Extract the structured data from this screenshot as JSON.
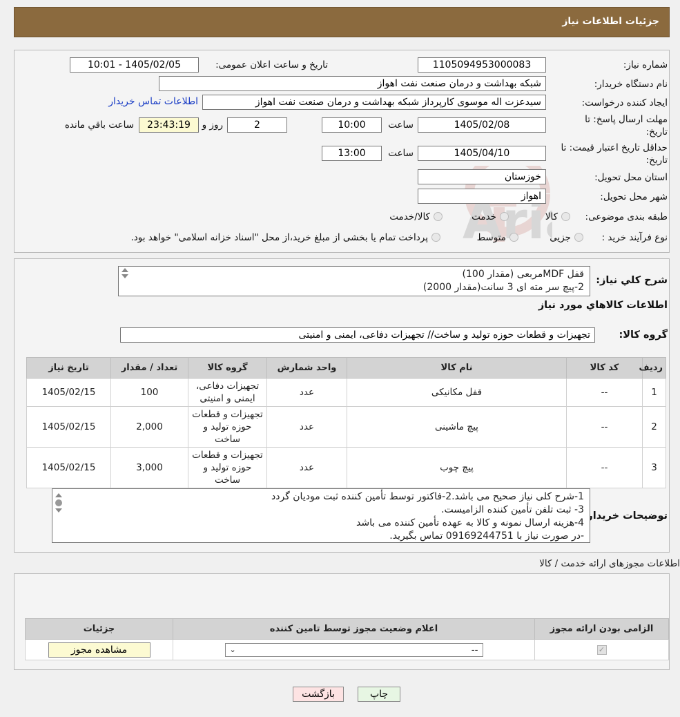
{
  "header": {
    "title": "جزئیات اطلاعات نیاز"
  },
  "form": {
    "need_number_label": "شماره نیاز:",
    "need_number": "1105094953000083",
    "announce_label": "تاریخ و ساعت اعلان عمومی:",
    "announce_value": "1405/02/05 - 10:01",
    "buyer_org_label": "نام دستگاه خریدار:",
    "buyer_org": "شبکه بهداشت و درمان صنعت نفت اهواز",
    "creator_label": "ایجاد کننده درخواست:",
    "creator": "سیدعزت اله موسوی کارپرداز شبکه بهداشت و درمان صنعت نفت اهواز",
    "contact_link": "اطلاعات تماس خریدار",
    "deadline_label_1": "مهلت ارسال پاسخ: تا",
    "deadline_label_2": "تاریخ:",
    "deadline_date": "1405/02/08",
    "time_label": "ساعت",
    "deadline_time": "10:00",
    "days_remaining": "2",
    "days_and_label": "روز و",
    "time_remaining": "23:43:19",
    "remaining_label": "ساعت باقي مانده",
    "validity_label_1": "حداقل تاریخ اعتبار قیمت: تا",
    "validity_label_2": "تاریخ:",
    "validity_date": "1405/04/10",
    "validity_time": "13:00",
    "province_label": "استان محل تحویل:",
    "province": "خوزستان",
    "city_label": "شهر محل تحویل:",
    "city": "اهواز",
    "category_label": "طبقه بندی موضوعی:",
    "category_options": [
      "کالا",
      "خدمت",
      "کالا/خدمت"
    ],
    "purchase_type_label": "نوع فرآیند خرید :",
    "purchase_options": [
      "جزیی",
      "متوسط"
    ],
    "purchase_note": "پرداخت تمام یا بخشی از مبلغ خرید،از محل \"اسناد خزانه اسلامی\" خواهد بود."
  },
  "watermark": {
    "text": "AriaTender.neT"
  },
  "description": {
    "label": "شرح کلي نياز:",
    "lines": [
      "قفل MDFمربعی (مقدار 100)",
      "2-پیچ سر مته ای 3 سانت(مقدار 2000)"
    ]
  },
  "goods": {
    "section_title": "اطلاعات کالاهاي مورد نياز",
    "group_label": "گروه کالا:",
    "group_value": "تجهیزات و قطعات حوزه تولید و ساخت// تجهیزات دفاعی، ایمنی و امنیتی",
    "columns": [
      "رديف",
      "کد کالا",
      "نام کالا",
      "واحد شمارش",
      "گروه کالا",
      "تعداد / مقدار",
      "تاریخ نیاز"
    ],
    "rows": [
      {
        "row": "1",
        "code": "--",
        "name": "قفل مکانیکی",
        "unit": "عدد",
        "group": "تجهیزات دفاعی، ایمنی و امنیتی",
        "qty": "100",
        "date": "1405/02/15"
      },
      {
        "row": "2",
        "code": "--",
        "name": "پیچ ماشینی",
        "unit": "عدد",
        "group": "تجهیزات و قطعات حوزه تولید و ساخت",
        "qty": "2,000",
        "date": "1405/02/15"
      },
      {
        "row": "3",
        "code": "--",
        "name": "پیچ چوب",
        "unit": "عدد",
        "group": "تجهیزات و قطعات حوزه تولید و ساخت",
        "qty": "3,000",
        "date": "1405/02/15"
      }
    ]
  },
  "buyer_notes": {
    "label": "توضیحات خریدار:",
    "lines": [
      "1-شرح کلی نیاز صحیح می باشد.2-فاکتور توسط تأمین کننده ثبت مودیان گردد",
      "3- ثبت تلفن تأمین کننده الزامیست.",
      "4-هزینه ارسال نمونه و کالا به عهده تأمین کننده می باشد",
      "-در صورت نیاز با 09169244751 تماس بگیرید."
    ]
  },
  "permits": {
    "title": "اطلاعات مجوزهای ارائه خدمت / کالا",
    "columns": [
      "الزامی بودن ارائه مجوز",
      "اعلام وضعیت مجوز توسط تامین کننده",
      "جزئیات"
    ],
    "select_value": "--",
    "view_button": "مشاهده مجوز"
  },
  "actions": {
    "print": "چاپ",
    "back": "بازگشت"
  }
}
